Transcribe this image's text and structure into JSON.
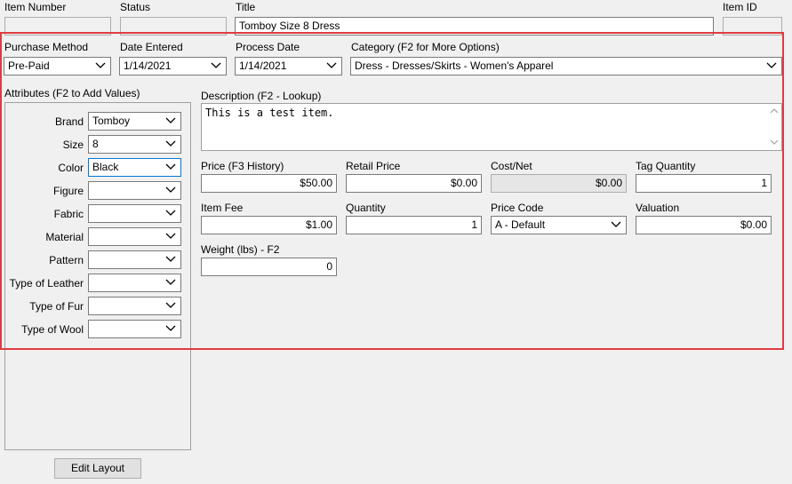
{
  "header": {
    "item_number_label": "Item Number",
    "status_label": "Status",
    "title_label": "Title",
    "title_value": "Tomboy Size 8 Dress",
    "item_id_label": "Item ID"
  },
  "purchase": {
    "purchase_method_label": "Purchase Method",
    "purchase_method_value": "Pre-Paid",
    "date_entered_label": "Date Entered",
    "date_entered_value": "1/14/2021",
    "process_date_label": "Process Date",
    "process_date_value": "1/14/2021",
    "category_label": "Category (F2 for More Options)",
    "category_value": "Dress - Dresses/Skirts - Women's Apparel"
  },
  "attributes": {
    "section_label": "Attributes (F2 to Add Values)",
    "rows": [
      {
        "label": "Brand",
        "value": "Tomboy"
      },
      {
        "label": "Size",
        "value": "8"
      },
      {
        "label": "Color",
        "value": "Black"
      },
      {
        "label": "Figure",
        "value": ""
      },
      {
        "label": "Fabric",
        "value": ""
      },
      {
        "label": "Material",
        "value": ""
      },
      {
        "label": "Pattern",
        "value": ""
      },
      {
        "label": "Type of Leather",
        "value": ""
      },
      {
        "label": "Type of Fur",
        "value": ""
      },
      {
        "label": "Type of Wool",
        "value": ""
      }
    ]
  },
  "description": {
    "label": "Description (F2 - Lookup)",
    "value": "This is a test item."
  },
  "pricing": {
    "price_label": "Price (F3 History)",
    "price_value": "$50.00",
    "retail_price_label": "Retail Price",
    "retail_price_value": "$0.00",
    "cost_net_label": "Cost/Net",
    "cost_net_value": "$0.00",
    "tag_quantity_label": "Tag Quantity",
    "tag_quantity_value": "1",
    "item_fee_label": "Item Fee",
    "item_fee_value": "$1.00",
    "quantity_label": "Quantity",
    "quantity_value": "1",
    "price_code_label": "Price Code",
    "price_code_value": "A - Default",
    "valuation_label": "Valuation",
    "valuation_value": "$0.00",
    "weight_label": "Weight (lbs) - F2",
    "weight_value": "0"
  },
  "footer": {
    "edit_layout_label": "Edit Layout"
  },
  "colors": {
    "highlight": "#e23a41",
    "focus_border": "#0078d7"
  }
}
